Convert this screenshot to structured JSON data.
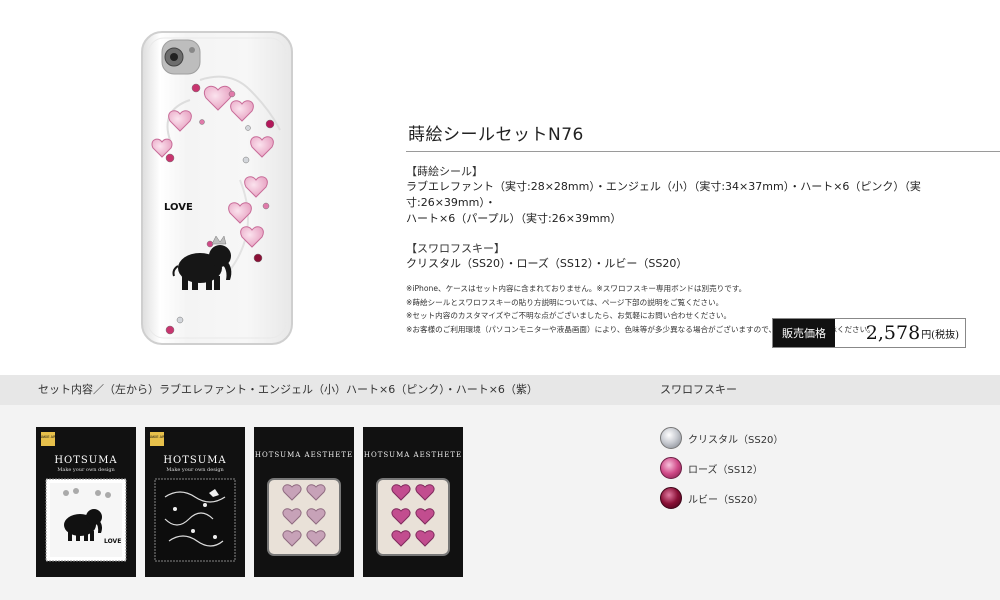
{
  "product": {
    "title": "蒔絵シールセットN76",
    "makie_heading": "【蒔絵シール】",
    "makie_body": "ラブエレファント（実寸:28×28mm）・エンジェル（小）（実寸:34×37mm）・ハート×6（ピンク）（実寸:26×39mm）・\nハート×6（パープル）（実寸:26×39mm）",
    "swarovski_heading": "【スワロフスキー】",
    "swarovski_body": "クリスタル（SS20）・ローズ（SS12）・ルビー（SS20）",
    "notes": [
      "※iPhone、ケースはセット内容に含まれておりません。※スワロフスキー専用ボンドは別売りです。",
      "※蒔絵シールとスワロフスキーの貼り方説明については、ページ下部の説明をご覧ください。",
      "※セット内容のカスタマイズやご不明な点がございましたら、お気軽にお問い合わせください。",
      "※お客様のご利用環境（パソコンモニターや液晶画面）により、色味等が多少異なる場合がございますので、あらかじめご了承ください。"
    ],
    "price_label": "販売価格",
    "price_value": "2,578",
    "price_unit": "円(税抜)",
    "phone_text": "LOVE"
  },
  "set_contents": {
    "heading": "セット内容／（左から）ラブエレファント・エンジェル（小）ハート×6（ピンク）・ハート×6（紫）",
    "packages": [
      {
        "brand": "HOTSUMA",
        "subtitle": "Make your own design",
        "badge": "MAKIE ART",
        "inner_text": "LOVE"
      },
      {
        "brand": "HOTSUMA",
        "subtitle": "Make your own design",
        "badge": "MAKIE ART"
      },
      {
        "brand": "HOTSUMA AESTHETE"
      },
      {
        "brand": "HOTSUMA AESTHETE"
      }
    ]
  },
  "swarovski": {
    "heading": "スワロフスキー",
    "items": [
      {
        "label": "クリスタル（SS20）",
        "color": "#b8bcc4"
      },
      {
        "label": "ローズ（SS12）",
        "color": "#d04a88"
      },
      {
        "label": "ルビー（SS20）",
        "color": "#8a1036"
      }
    ]
  }
}
